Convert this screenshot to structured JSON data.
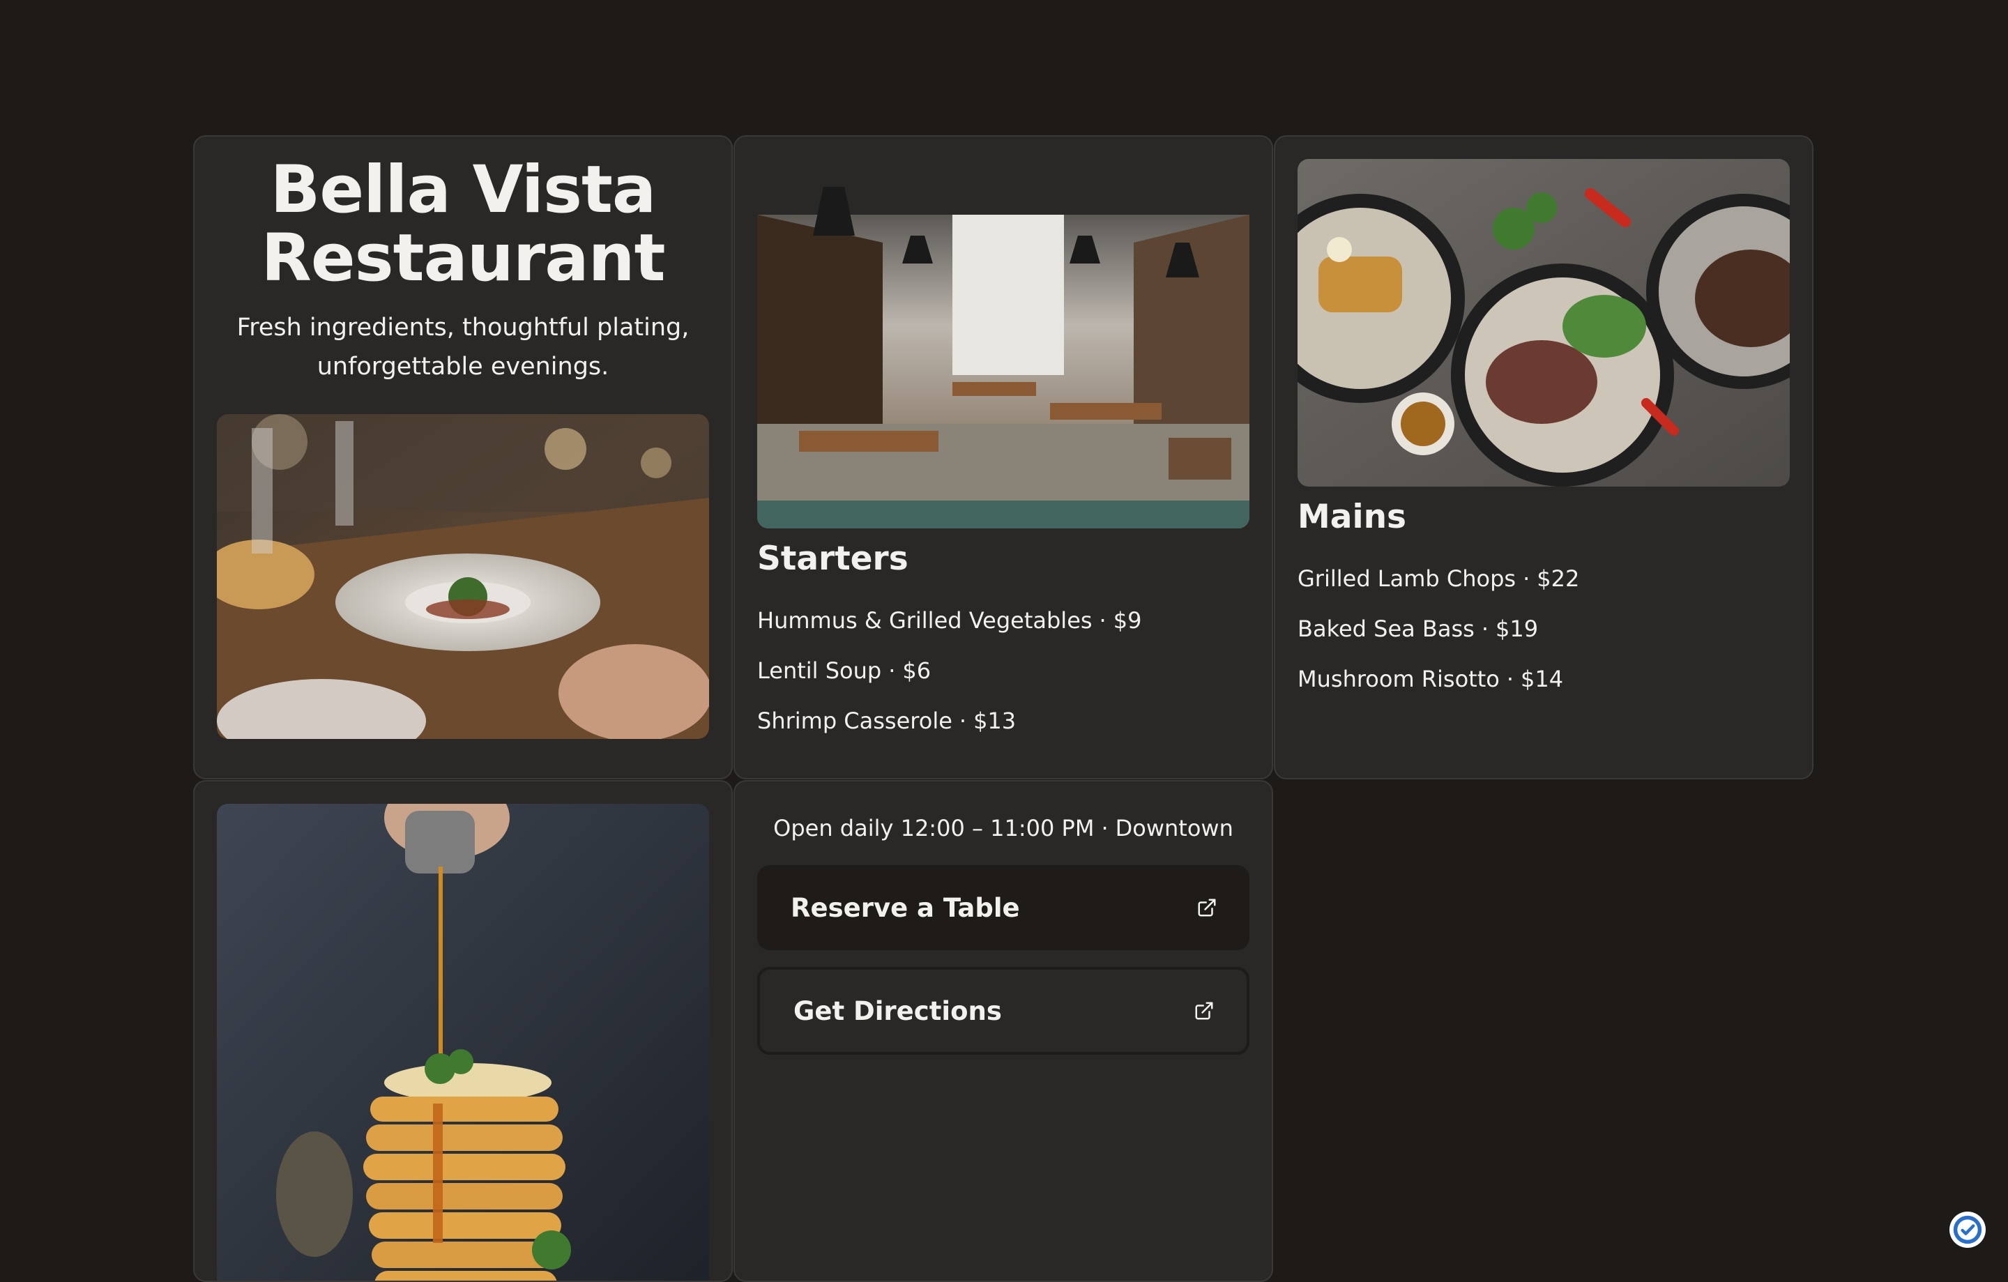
{
  "hero": {
    "title_line1": "Bella Vista",
    "title_line2": "Restaurant",
    "tagline_line1": "Fresh ingredients, thoughtful plating,",
    "tagline_line2": "unforgettable evenings."
  },
  "starters": {
    "title": "Starters",
    "items": [
      {
        "name": "Hummus & Grilled Vegetables",
        "price": "$9"
      },
      {
        "name": "Lentil Soup",
        "price": "$6"
      },
      {
        "name": "Shrimp Casserole",
        "price": "$13"
      }
    ]
  },
  "mains": {
    "title": "Mains",
    "items": [
      {
        "name": "Grilled Lamb Chops",
        "price": "$22"
      },
      {
        "name": "Baked Sea Bass",
        "price": "$19"
      },
      {
        "name": "Mushroom Risotto",
        "price": "$14"
      }
    ]
  },
  "info": {
    "hours": "Open daily 12:00 – 11:00 PM",
    "location": "Downtown",
    "reserve_label": "Reserve a Table",
    "directions_label": "Get Directions"
  },
  "separator": "·",
  "icons": {
    "external_link": "external-link-icon",
    "verify": "verified-check-icon"
  },
  "colors": {
    "background": "#1d1a18",
    "card": "#292827",
    "button_dark": "#1e1b19",
    "text": "#f3f1ee",
    "badge": "#2a6fc9"
  }
}
